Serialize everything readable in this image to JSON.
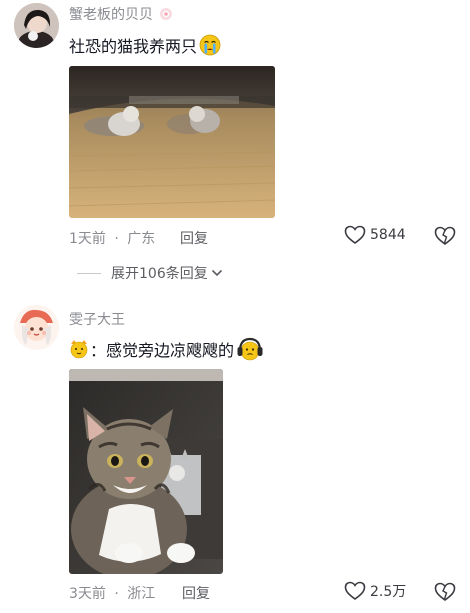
{
  "comments": [
    {
      "username": "蟹老板的贝贝",
      "text": "社恐的猫我养两只",
      "emoji": "crying-face-emoji",
      "time": "1天前",
      "location": "广东",
      "reply_label": "回复",
      "likes": "5844"
    },
    {
      "username": "雯子大王",
      "text_prefix": "：感觉旁边凉飕飕的",
      "emoji": "headphones-face-emoji",
      "time": "3天前",
      "location": "浙江",
      "reply_label": "回复",
      "likes": "2.5万"
    }
  ],
  "expand_replies": "展开106条回复",
  "separator": "·",
  "colors": {
    "text": "#161823",
    "meta": "#8a8b91",
    "emoji_yellow": "#f5c518"
  }
}
